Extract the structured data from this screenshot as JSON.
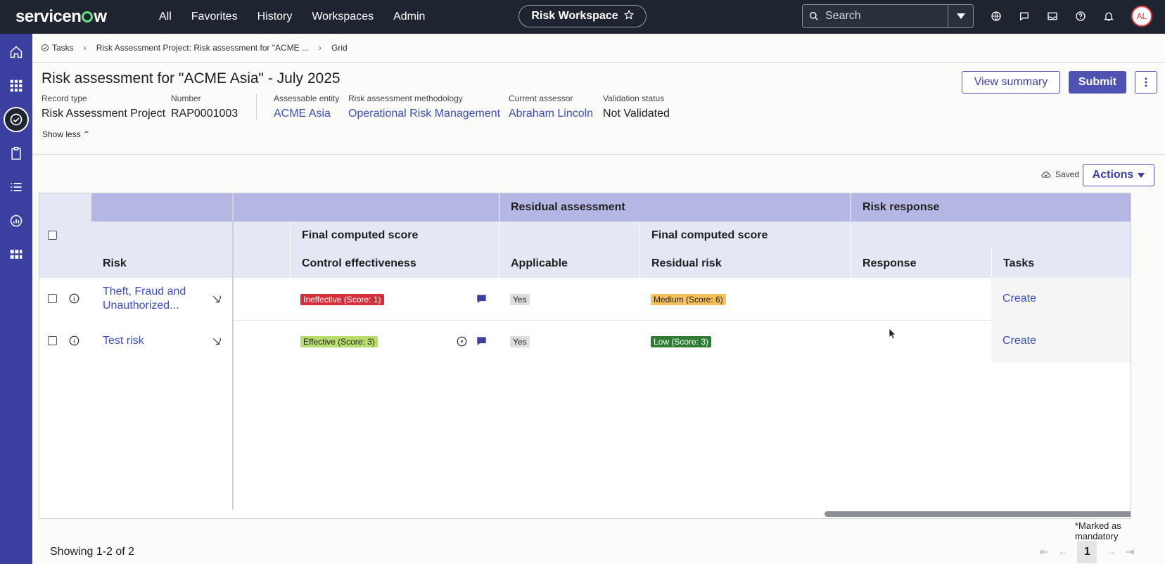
{
  "topnav": {
    "logo": "servicenow",
    "links": [
      "All",
      "Favorites",
      "History",
      "Workspaces",
      "Admin"
    ],
    "workspace": "Risk Workspace",
    "search_placeholder": "Search",
    "avatar": "AL"
  },
  "breadcrumb": {
    "items": [
      "Tasks",
      "Risk Assessment Project: Risk assessment for \"ACME ...",
      "Grid"
    ]
  },
  "header": {
    "title": "Risk assessment for \"ACME Asia\" - July 2025",
    "view_summary": "View summary",
    "submit": "Submit",
    "fields": [
      {
        "label": "Record type",
        "value": "Risk Assessment Project"
      },
      {
        "label": "Number",
        "value": "RAP0001003"
      },
      {
        "label": "Assessable entity",
        "value": "ACME Asia"
      },
      {
        "label": "Risk assessment methodology",
        "value": "Operational Risk Management"
      },
      {
        "label": "Current assessor",
        "value": "Abraham Lincoln"
      },
      {
        "label": "Validation status",
        "value": "Not Validated"
      }
    ],
    "show_less": "Show less"
  },
  "toolbar": {
    "saved": "Saved",
    "actions": "Actions"
  },
  "grid": {
    "group_headers": {
      "residual": "Residual assessment",
      "response": "Risk response"
    },
    "sub_headers": {
      "final1": "Final computed score",
      "final2": "Final computed score"
    },
    "columns": {
      "risk": "Risk",
      "control": "Control effectiveness",
      "applicable": "Applicable",
      "residual": "Residual risk",
      "response": "Response",
      "tasks": "Tasks"
    },
    "rows": [
      {
        "risk": "Theft, Fraud and Unauthorized...",
        "control": "Ineffective (Score: 1)",
        "applicable": "Yes",
        "residual": "Medium (Score: 6)",
        "tasks": "Create"
      },
      {
        "risk": "Test risk",
        "control": "Effective (Score: 3)",
        "applicable": "Yes",
        "residual": "Low (Score: 3)",
        "tasks": "Create"
      }
    ]
  },
  "footer": {
    "mandatory": "*Marked as mandatory",
    "showing": "Showing 1-2 of 2",
    "page": "1"
  }
}
